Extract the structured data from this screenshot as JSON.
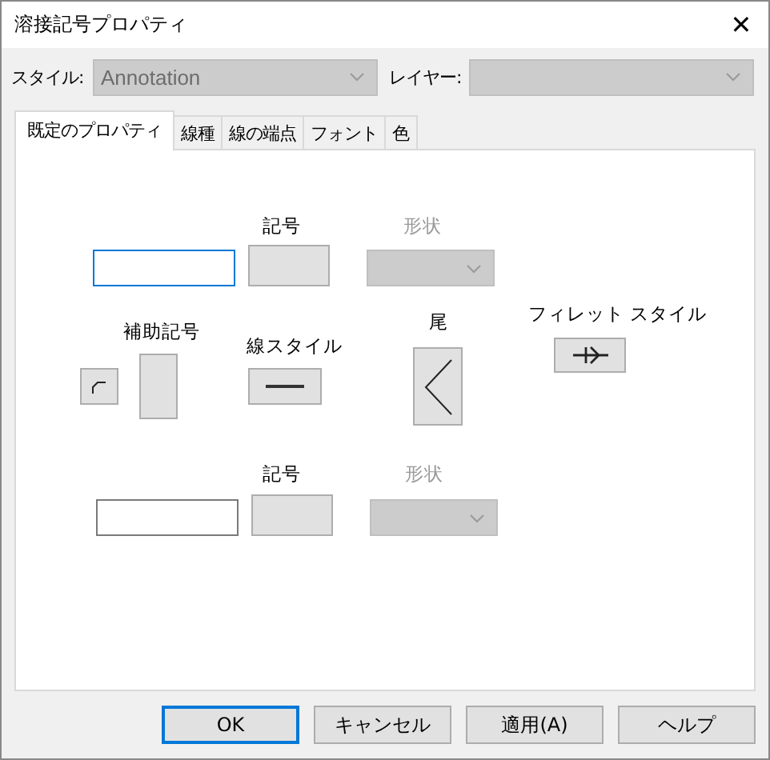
{
  "window": {
    "title": "溶接記号プロパティ",
    "close": "✕"
  },
  "style": {
    "label": "スタイル:",
    "value": "Annotation",
    "disabled": true
  },
  "layer": {
    "label": "レイヤー:",
    "disabled": true
  },
  "tabs": [
    {
      "label": "既定のプロパティ",
      "selected": true
    },
    {
      "label": "線種",
      "selected": false
    },
    {
      "label": "線の端点",
      "selected": false
    },
    {
      "label": "フォント",
      "selected": false
    },
    {
      "label": "色",
      "selected": false
    }
  ],
  "upper": {
    "symbol_label": "記号",
    "shape_label": "形状",
    "shape_disabled": true,
    "text_focused": true
  },
  "supplementary": {
    "label": "補助記号"
  },
  "line_style": {
    "label": "線スタイル"
  },
  "tail": {
    "label": "尾"
  },
  "fillet_style": {
    "label": "フィレット スタイル"
  },
  "lower": {
    "symbol_label": "記号",
    "shape_label": "形状",
    "shape_disabled": true,
    "text_focused": false
  },
  "buttons": [
    {
      "label": "OK",
      "default": true
    },
    {
      "label": "キャンセル",
      "default": false
    },
    {
      "label": "適用(A)",
      "default": false
    },
    {
      "label": "ヘルプ",
      "default": false
    }
  ]
}
